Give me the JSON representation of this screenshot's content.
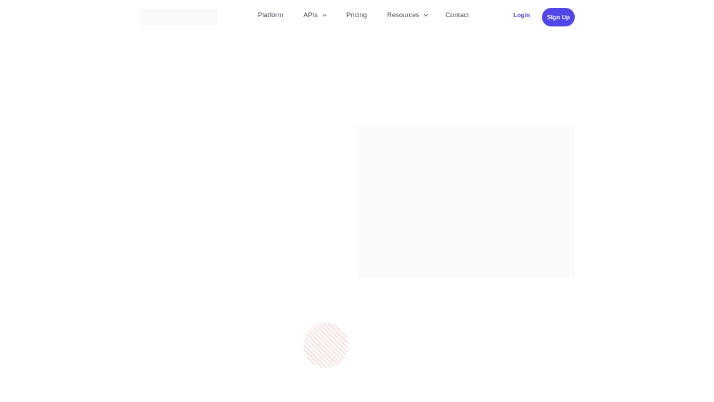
{
  "header": {
    "nav": {
      "platform": "Platform",
      "apis": "APIs",
      "pricing": "Pricing",
      "resources": "Resources",
      "contact": "Contact"
    },
    "login_label": "Login",
    "signup_label": "Sign Up"
  },
  "icons": {
    "apis_dropdown": "chevron-down-icon",
    "resources_dropdown": "chevron-down-icon"
  },
  "colors": {
    "accent": "#4f46e5",
    "nav_text": "#4b4f5c",
    "placeholder_bg": "#f8fafc",
    "decor_stripe": "#fbd5d5"
  }
}
